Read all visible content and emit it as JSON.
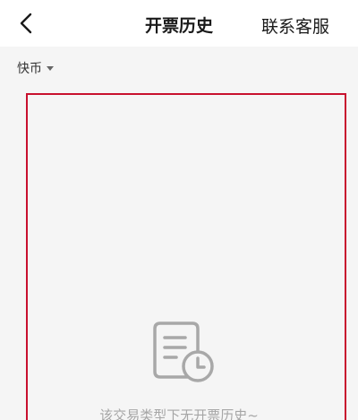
{
  "header": {
    "title": "开票历史",
    "service_label": "联系客服",
    "back_icon": "chevron-left-icon"
  },
  "filter": {
    "selected": "快币",
    "icon": "caret-down-icon"
  },
  "empty_state": {
    "icon": "document-clock-icon",
    "message": "该交易类型下无开票历史~"
  },
  "colors": {
    "highlight_border": "#c8102e",
    "background": "#f5f5f5",
    "empty_icon": "#a8a8a8",
    "empty_text": "#a6a6a6"
  }
}
